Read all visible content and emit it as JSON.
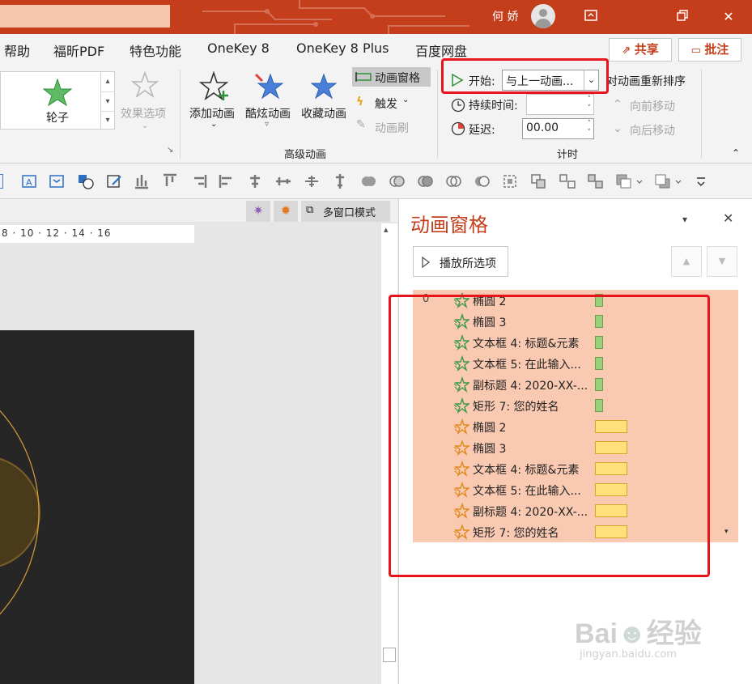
{
  "titlebar": {
    "user_name": "何 娇",
    "window_controls": {
      "ribbon_icon": "ribbon-display-icon",
      "restore_icon": "restore-icon",
      "close_icon": "close-icon",
      "close_label": "✕"
    }
  },
  "menu": {
    "tabs": [
      "帮助",
      "福昕PDF",
      "特色功能",
      "OneKey 8",
      "OneKey 8 Plus",
      "百度网盘"
    ],
    "share_label": "共享",
    "comment_label": "批注"
  },
  "ribbon": {
    "effect": {
      "label": "轮子"
    },
    "effect_options": {
      "label": "效果选项"
    },
    "add_animation": {
      "label": "添加动画"
    },
    "cool_animation": {
      "label": "酷炫动画"
    },
    "fav_animation": {
      "label": "收藏动画"
    },
    "anim_pane": {
      "label": "动画窗格"
    },
    "trigger": {
      "label": "触发"
    },
    "anim_painter": {
      "label": "动画刷"
    },
    "group_advanced": "高级动画",
    "timing": {
      "start_label": "开始:",
      "start_value": "与上一动画...",
      "duration_label": "持续时间:",
      "duration_value": "",
      "delay_label": "延迟:",
      "delay_value": "00.00",
      "reorder_label": "对动画重新排序",
      "move_earlier": "向前移动",
      "move_later": "向后移动",
      "group_label": "计时"
    }
  },
  "slidearea": {
    "multi_window": "多窗口模式",
    "ruler_text": "8 · 10 · 12 · 14 · 16"
  },
  "animpane": {
    "title": "动画窗格",
    "play_label": "播放所选项",
    "items": [
      {
        "num": "0",
        "label": "椭圆 2",
        "type": "green"
      },
      {
        "num": "",
        "label": "椭圆 3",
        "type": "green"
      },
      {
        "num": "",
        "label": "文本框 4: 标题&元素",
        "type": "green"
      },
      {
        "num": "",
        "label": "文本框 5: 在此输入...",
        "type": "green"
      },
      {
        "num": "",
        "label": "副标题 4: 2020-XX-...",
        "type": "green"
      },
      {
        "num": "",
        "label": "矩形 7: 您的姓名",
        "type": "green"
      },
      {
        "num": "",
        "label": "椭圆 2",
        "type": "yellow"
      },
      {
        "num": "",
        "label": "椭圆 3",
        "type": "yellow"
      },
      {
        "num": "",
        "label": "文本框 4: 标题&元素",
        "type": "yellow"
      },
      {
        "num": "",
        "label": "文本框 5: 在此输入...",
        "type": "yellow"
      },
      {
        "num": "",
        "label": "副标题 4: 2020-XX-...",
        "type": "yellow"
      },
      {
        "num": "",
        "label": "矩形 7: 您的姓名",
        "type": "yellow"
      }
    ]
  },
  "colors": {
    "accent": "#c43e1c",
    "highlight": "#e8141b",
    "list_bg": "#f9c9b1"
  }
}
